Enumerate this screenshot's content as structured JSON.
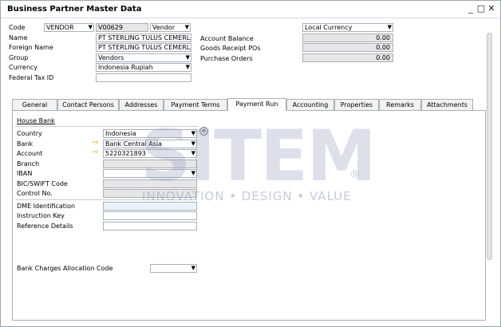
{
  "window": {
    "title": "Business Partner Master Data",
    "controls": {
      "minimize": "_",
      "maximize": "□",
      "close": "✕"
    }
  },
  "header": {
    "code_label": "Code",
    "code_series": "VENDOR",
    "code_value": "V00629",
    "type_value": "Vendor",
    "name_label": "Name",
    "name_value": "PT STERLING TULUS CEMERLA",
    "foreign_name_label": "Foreign Name",
    "foreign_name_value": "PT STERLING TULUS CEMERLA",
    "group_label": "Group",
    "group_value": "Vendors",
    "currency_label": "Currency",
    "currency_value": "Indonesia Rupiah",
    "federal_tax_label": "Federal Tax ID",
    "federal_tax_value": "",
    "currency_view": "Local Currency",
    "account_balance_label": "Account Balance",
    "account_balance_value": "0.00",
    "goods_receipt_label": "Goods Receipt POs",
    "goods_receipt_value": "0.00",
    "purchase_orders_label": "Purchase Orders",
    "purchase_orders_value": "0.00"
  },
  "tabs": [
    {
      "label": "General",
      "active": false
    },
    {
      "label": "Contact Persons",
      "active": false
    },
    {
      "label": "Addresses",
      "active": false
    },
    {
      "label": "Payment Terms",
      "active": false
    },
    {
      "label": "Payment Run",
      "active": true
    },
    {
      "label": "Accounting",
      "active": false
    },
    {
      "label": "Properties",
      "active": false
    },
    {
      "label": "Remarks",
      "active": false
    },
    {
      "label": "Attachments",
      "active": false
    }
  ],
  "payment_run": {
    "house_bank_label": "House Bank",
    "country_label": "Country",
    "country_value": "Indonesia",
    "bank_label": "Bank",
    "bank_value": "Bank Central Asia",
    "account_label": "Account",
    "account_value": "5220321893",
    "branch_label": "Branch",
    "iban_label": "IBAN",
    "bic_label": "BIC/SWIFT Code",
    "control_no_label": "Control No.",
    "dme_label": "DME Identification",
    "instruction_key_label": "Instruction Key",
    "reference_details_label": "Reference Details",
    "bank_charges_label": "Bank Charges Allocation Code"
  },
  "watermark": {
    "letters": "SITEM",
    "registered": "®",
    "tagline": "INNOVATION • DESIGN • VALUE"
  },
  "colors": {
    "link_arrow": "#e7a51c",
    "watermark": "#96a0be",
    "field_border": "#a8b0ba"
  }
}
